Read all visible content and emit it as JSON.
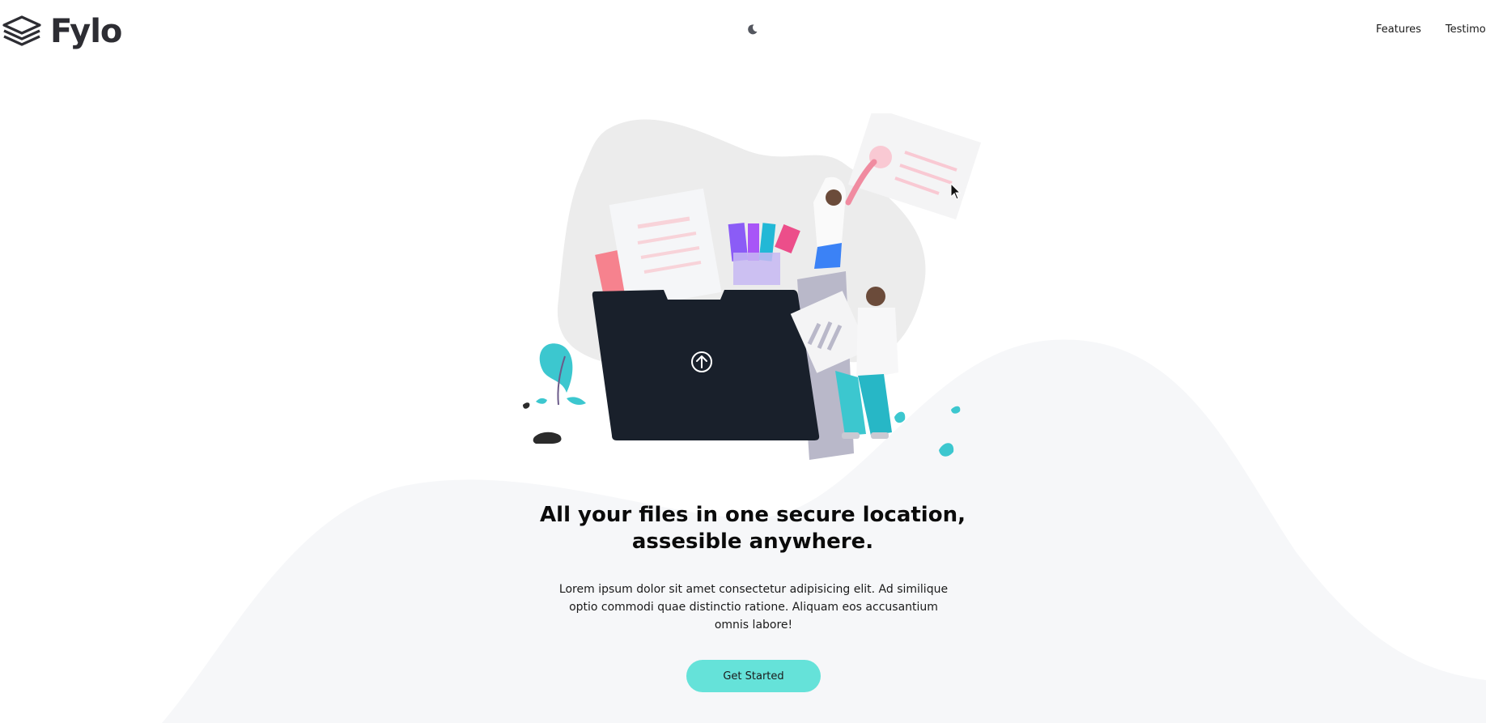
{
  "header": {
    "logo_text": "Fylo",
    "theme_toggle_icon": "moon-icon",
    "nav": [
      {
        "label": "Features"
      },
      {
        "label": "Testimonials"
      }
    ]
  },
  "hero": {
    "illustration_icon": "upload-icon",
    "title": "All your files in one secure location, assesible anywhere.",
    "description": "Lorem ipsum dolor sit amet consectetur adipisicing elit. Ad similique optio commodi quae distinctio ratione. Aliquam eos accusantium omnis labore!",
    "cta_label": "Get Started"
  },
  "colors": {
    "accent": "#65e2d9",
    "background": "#ffffff",
    "curve": "#f6f7f9",
    "folder": "#19202b",
    "logo": "#2d2d33"
  }
}
